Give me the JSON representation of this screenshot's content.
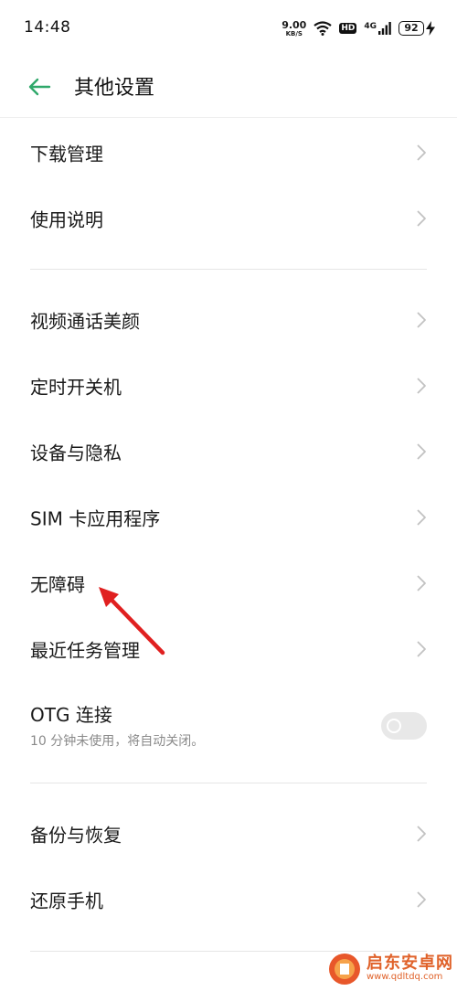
{
  "status_bar": {
    "time": "14:48",
    "net_speed": "9.00",
    "net_speed_unit": "KB/S",
    "hd": "HD",
    "signal": "4G",
    "battery": "92"
  },
  "header": {
    "title": "其他设置",
    "back_icon": "arrow-left-icon",
    "accent": "#2fa86a"
  },
  "groups": [
    {
      "items": [
        {
          "label": "下载管理"
        },
        {
          "label": "使用说明"
        }
      ]
    },
    {
      "items": [
        {
          "label": "视频通话美颜"
        },
        {
          "label": "定时开关机"
        },
        {
          "label": "设备与隐私"
        },
        {
          "label": "SIM 卡应用程序"
        },
        {
          "label": "无障碍"
        },
        {
          "label": "最近任务管理"
        }
      ],
      "toggle_item": {
        "label": "OTG 连接",
        "sublabel": "10 分钟未使用，将自动关闭。",
        "enabled": false
      }
    },
    {
      "items": [
        {
          "label": "备份与恢复"
        },
        {
          "label": "还原手机"
        }
      ]
    }
  ],
  "annotation": {
    "color": "#e02020",
    "target": "无障碍"
  },
  "watermark": {
    "line1": "启东安卓网",
    "line2": "www.qdltdq.com"
  }
}
